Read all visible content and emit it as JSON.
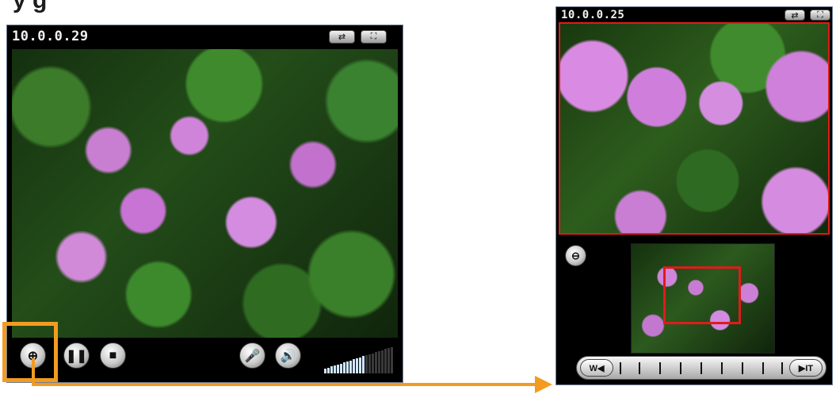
{
  "page": {
    "heading": "y                                   g"
  },
  "left_viewer": {
    "ip_address": "10.0.0.29",
    "controls": {
      "zoom": "zoom-in-icon",
      "pause": "pause-icon",
      "stop": "stop-icon",
      "mic": "microphone-icon",
      "speaker": "speaker-icon"
    },
    "volume_level_fraction": 0.55
  },
  "right_viewer": {
    "ip_address": "10.0.0.25",
    "controls": {
      "zoom": "zoom-out-icon"
    },
    "timeline": {
      "rewind_label": "W◀",
      "forward_label": "▶IT"
    }
  },
  "colors": {
    "highlight": "#f39b20",
    "selection": "#e01b1b",
    "window_bg": "#000000"
  }
}
